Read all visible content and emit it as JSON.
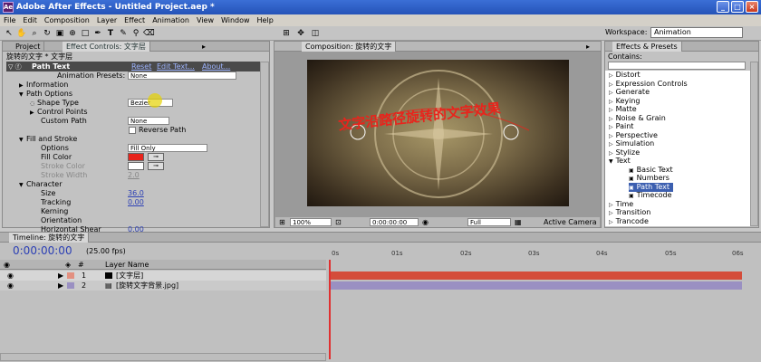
{
  "window": {
    "title": "Adobe After Effects - Untitled Project.aep *",
    "icon": "ae-icon",
    "min": "_",
    "max": "□",
    "close": "×"
  },
  "menu": [
    "File",
    "Edit",
    "Composition",
    "Layer",
    "Effect",
    "Animation",
    "View",
    "Window",
    "Help"
  ],
  "toolbar": {
    "workspace_label": "Workspace:",
    "workspace_value": "Animation"
  },
  "effect_controls": {
    "tabs": [
      "Project",
      "Effect Controls: 文字层"
    ],
    "header": "旋转的文字 * 文字层",
    "effect_name": "Path Text",
    "links": [
      "Reset",
      "Edit Text...",
      "About..."
    ],
    "presets_label": "Animation Presets:",
    "presets_value": "None",
    "props": [
      "Information",
      "Path Options",
      "Shape Type",
      "Control Points",
      "Custom Path",
      "Reverse Path",
      "Fill and Stroke",
      "Options",
      "Fill Color",
      "Stroke Color",
      "Stroke Width",
      "Character",
      "Size",
      "Tracking",
      "Kerning",
      "Orientation",
      "Horizontal Shear"
    ],
    "values": {
      "shape_type": "Bezier",
      "custom_path": "None",
      "options": "Fill Only",
      "stroke_width": "2.0",
      "size": "36.0",
      "tracking": "0.00",
      "horizontal_shear": "0.00"
    },
    "colors": {
      "fill": "#e8241c",
      "stroke": "#ffffff"
    }
  },
  "composition": {
    "tab": "Composition: 旋转的文字",
    "path_text": "文字沿路径旋转的文字效果",
    "zoom": "100%",
    "time": "0:00:00:00",
    "resolution": "Full",
    "camera": "Active Camera"
  },
  "effects_presets": {
    "tab": "Effects & Presets",
    "contains_label": "Contains:",
    "items": [
      "Distort",
      "Expression Controls",
      "Generate",
      "Keying",
      "Matte",
      "Noise & Grain",
      "Paint",
      "Perspective",
      "Simulation",
      "Stylize",
      "Text",
      "Basic Text",
      "Numbers",
      "Path Text",
      "Timecode",
      "Time",
      "Transition",
      "Trancode"
    ]
  },
  "timeline": {
    "tab": "Timeline: 旋转的文字",
    "time": "0:00:00:00",
    "fps": "(25.00 fps)",
    "col_layer_name": "Layer Name",
    "layers": [
      {
        "num": "1",
        "name": "[文字层]"
      },
      {
        "num": "2",
        "name": "[旋转文字背景.jpg]"
      }
    ],
    "ruler": [
      "0s",
      "01s",
      "02s",
      "03s",
      "04s",
      "05s",
      "06s"
    ],
    "layer_colors": {
      "layer1": "#d44c3a",
      "layer2": "#9a90c2"
    }
  }
}
